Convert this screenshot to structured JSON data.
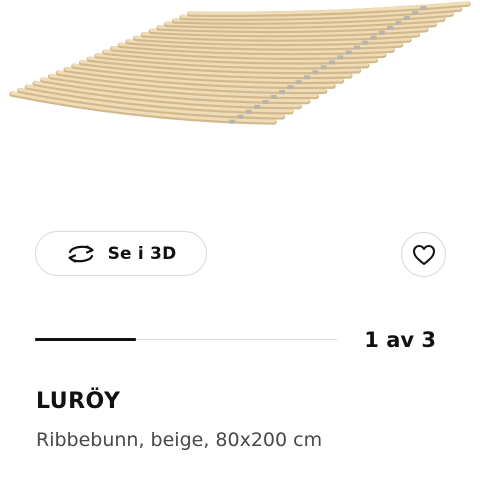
{
  "product": {
    "image_name": "slatted-bed-base-image",
    "name": "LURÖY",
    "description": "Ribbebunn, beige, 80x200 cm"
  },
  "actions": {
    "view_3d_label": "Se i 3D",
    "view_3d_icon": "rotate-3d-icon",
    "favourite_icon": "heart-outline-icon"
  },
  "carousel": {
    "counter_text": "1 av 3",
    "current": 1,
    "total": 3
  },
  "colors": {
    "text_primary": "#111111",
    "text_secondary": "#484848",
    "border": "#d9d9d9",
    "slat_wood": "#f0dcb6",
    "slat_edge": "#d2b98d"
  }
}
